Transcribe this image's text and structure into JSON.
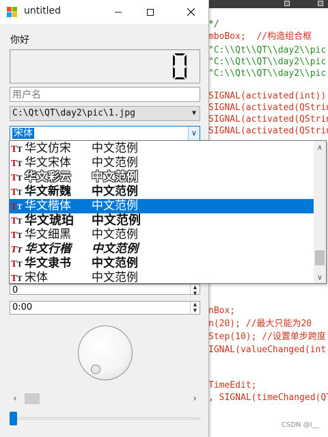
{
  "window": {
    "title": "untitled",
    "hello_text": "你好",
    "lcd_value": "0",
    "username_placeholder": "用户名",
    "path_combo_value": "C:\\Qt\\QT\\day2\\pic\\1.jpg",
    "font_combo_value": "宋体",
    "font_list": {
      "items": [
        {
          "name": "华文仿宋",
          "sample": "中文范例",
          "selected": false
        },
        {
          "name": "华文宋体",
          "sample": "中文范例",
          "selected": false
        },
        {
          "name": "华文彩云",
          "sample": "中文范例",
          "selected": false
        },
        {
          "name": "华文新魏",
          "sample": "中文范例",
          "selected": false
        },
        {
          "name": "华文楷体",
          "sample": "中文范例",
          "selected": true
        },
        {
          "name": "华文琥珀",
          "sample": "中文范例",
          "selected": false
        },
        {
          "name": "华文细黑",
          "sample": "中文范例",
          "selected": false
        },
        {
          "name": "华文行楷",
          "sample": "中文范例",
          "selected": false
        },
        {
          "name": "华文隶书",
          "sample": "中文范例",
          "selected": false
        },
        {
          "name": "宋体",
          "sample": "中文范例",
          "selected": false
        }
      ],
      "icon": "truetype-font-icon"
    },
    "spinbox_value": "0",
    "time_edit_value": "0:00"
  },
  "editor": {
    "lines": [
      {
        "text": "*/",
        "kind": "comment"
      },
      {
        "text": "mboBox;  //构造组合框",
        "kind": "mixed"
      },
      {
        "text": "\"C:\\\\Qt\\\\QT\\\\day2\\\\pic",
        "kind": "string"
      },
      {
        "text": "\"C:\\\\Qt\\\\QT\\\\day2\\\\pic",
        "kind": "string"
      },
      {
        "text": "\"C:\\\\Qt\\\\QT\\\\day2\\\\pic",
        "kind": "string"
      },
      {
        "text": "SIGNAL(activated(int))",
        "kind": "signal"
      },
      {
        "text": "SIGNAL(activated(QStrin",
        "kind": "signal"
      },
      {
        "text": "SIGNAL(activated(QStrin",
        "kind": "signal"
      },
      {
        "text": "SIGNAL(activated(QStrin",
        "kind": "signal"
      },
      {
        "text": "nBox;",
        "kind": "plain"
      },
      {
        "text": "n(20); //最大只能为20",
        "kind": "mixed"
      },
      {
        "text": "Step(10); //设置单步跨度",
        "kind": "mixed"
      },
      {
        "text": "IGNAL(valueChanged(int",
        "kind": "signal"
      },
      {
        "text": "TimeEdit;",
        "kind": "plain"
      },
      {
        "text": ", SIGNAL(timeChanged(QT",
        "kind": "signal"
      }
    ],
    "watermark": "CSDN @I__"
  },
  "colors": {
    "accent": "#0078d7",
    "keyword": "#c9341f",
    "comment": "#1f7a1f"
  }
}
